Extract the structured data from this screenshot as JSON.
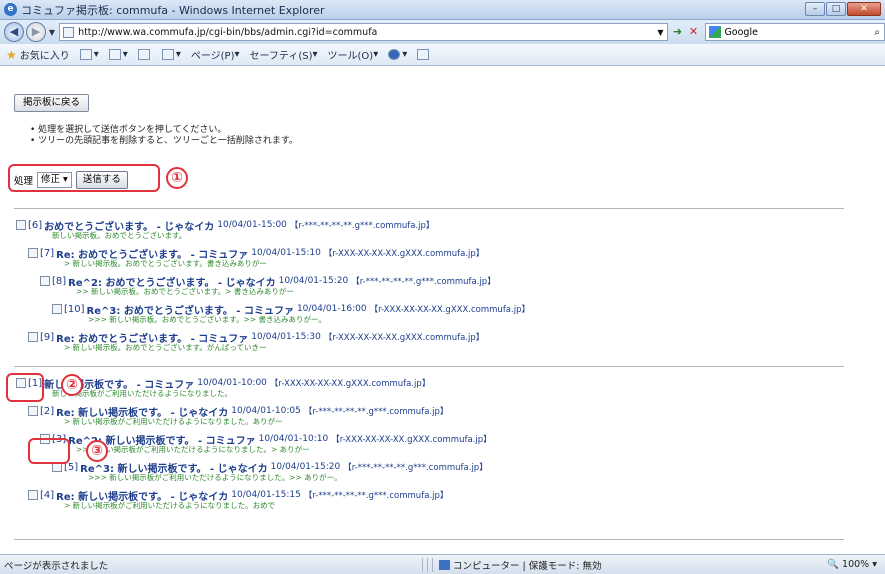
{
  "window": {
    "title": "コミュファ掲示板: commufa - Windows Internet Explorer",
    "controls": {
      "minimize": "–",
      "maximize": "□",
      "close": "✕"
    }
  },
  "address": {
    "url": "http://www.wa.commufa.jp/cgi-bin/bbs/admin.cgi?id=commufa",
    "search_engine": "Google"
  },
  "command_bar": {
    "favorites": "お気に入り",
    "page": "ページ(P)",
    "safety": "セーフティ(S)",
    "tools": "ツール(O)"
  },
  "page": {
    "back_button": "掲示板に戻る",
    "notes": [
      "処理を選択して送信ボタンを押してください。",
      "ツリーの先頭記事を削除すると、ツリーごと一括削除されます。"
    ],
    "action_label": "処理",
    "action_value": "修正",
    "submit_label": "送信する",
    "callouts": {
      "one": "①",
      "two": "②",
      "three": "③"
    }
  },
  "threads": [
    {
      "posts": [
        {
          "id": "[6]",
          "subject": "おめでとうございます。 - じゃなイカ",
          "meta": "10/04/01-15:00",
          "host": "【r-***-**-**-**.g***.commufa.jp】",
          "body": "新しい掲示板。おめでとうございます。",
          "indent": 0
        },
        {
          "id": "[7]",
          "subject": "Re: おめでとうございます。 - コミュファ",
          "meta": "10/04/01-15:10",
          "host": "【r-XXX-XX-XX-XX.gXXX.commufa.jp】",
          "body": "> 新しい掲示板。おめでとうございます。書き込みありがー",
          "indent": 1
        },
        {
          "id": "[8]",
          "subject": "Re^2: おめでとうございます。 - じゃなイカ",
          "meta": "10/04/01-15:20",
          "host": "【r-***-**-**-**.g***.commufa.jp】",
          "body": ">> 新しい掲示板。おめでとうございます。> 書き込みありがー",
          "indent": 2
        },
        {
          "id": "[10]",
          "subject": "Re^3: おめでとうございます。 - コミュファ",
          "meta": "10/04/01-16:00",
          "host": "【r-XXX-XX-XX-XX.gXXX.commufa.jp】",
          "body": ">>> 新しい掲示板。おめでとうございます。>> 書き込みありがー。",
          "indent": 3
        },
        {
          "id": "[9]",
          "subject": "Re: おめでとうございます。 - コミュファ",
          "meta": "10/04/01-15:30",
          "host": "【r-XXX-XX-XX-XX.gXXX.commufa.jp】",
          "body": "> 新しい掲示板。おめでとうございます。がんばっていきー",
          "indent": 1
        }
      ]
    },
    {
      "posts": [
        {
          "id": "[1]",
          "subject": "新しい掲示板です。 - コミュファ",
          "meta": "10/04/01-10:00",
          "host": "【r-XXX-XX-XX-XX.gXXX.commufa.jp】",
          "body": "新しい掲示板がご利用いただけるようになりました。",
          "indent": 0
        },
        {
          "id": "[2]",
          "subject": "Re: 新しい掲示板です。 - じゃなイカ",
          "meta": "10/04/01-10:05",
          "host": "【r-***-**-**-**.g***.commufa.jp】",
          "body": "> 新しい掲示板がご利用いただけるようになりました。ありがー",
          "indent": 1
        },
        {
          "id": "[3]",
          "subject": "Re^2: 新しい掲示板です。 - コミュファ",
          "meta": "10/04/01-10:10",
          "host": "【r-XXX-XX-XX-XX.gXXX.commufa.jp】",
          "body": ">> 新しい掲示板がご利用いただけるようになりました。> ありがー",
          "indent": 2
        },
        {
          "id": "[5]",
          "subject": "Re^3: 新しい掲示板です。 - じゃなイカ",
          "meta": "10/04/01-15:20",
          "host": "【r-***-**-**-**.g***.commufa.jp】",
          "body": ">>> 新しい掲示板がご利用いただけるようになりました。>> ありがー。",
          "indent": 3
        },
        {
          "id": "[4]",
          "subject": "Re: 新しい掲示板です。 - じゃなイカ",
          "meta": "10/04/01-15:15",
          "host": "【r-***-**-**-**.g***.commufa.jp】",
          "body": "> 新しい掲示板がご利用いただけるようになりました。おめで",
          "indent": 1
        }
      ]
    }
  ],
  "status": {
    "left": "ページが表示されました",
    "zone": "コンピューター | 保護モード: 無効",
    "zoom": "100%"
  }
}
